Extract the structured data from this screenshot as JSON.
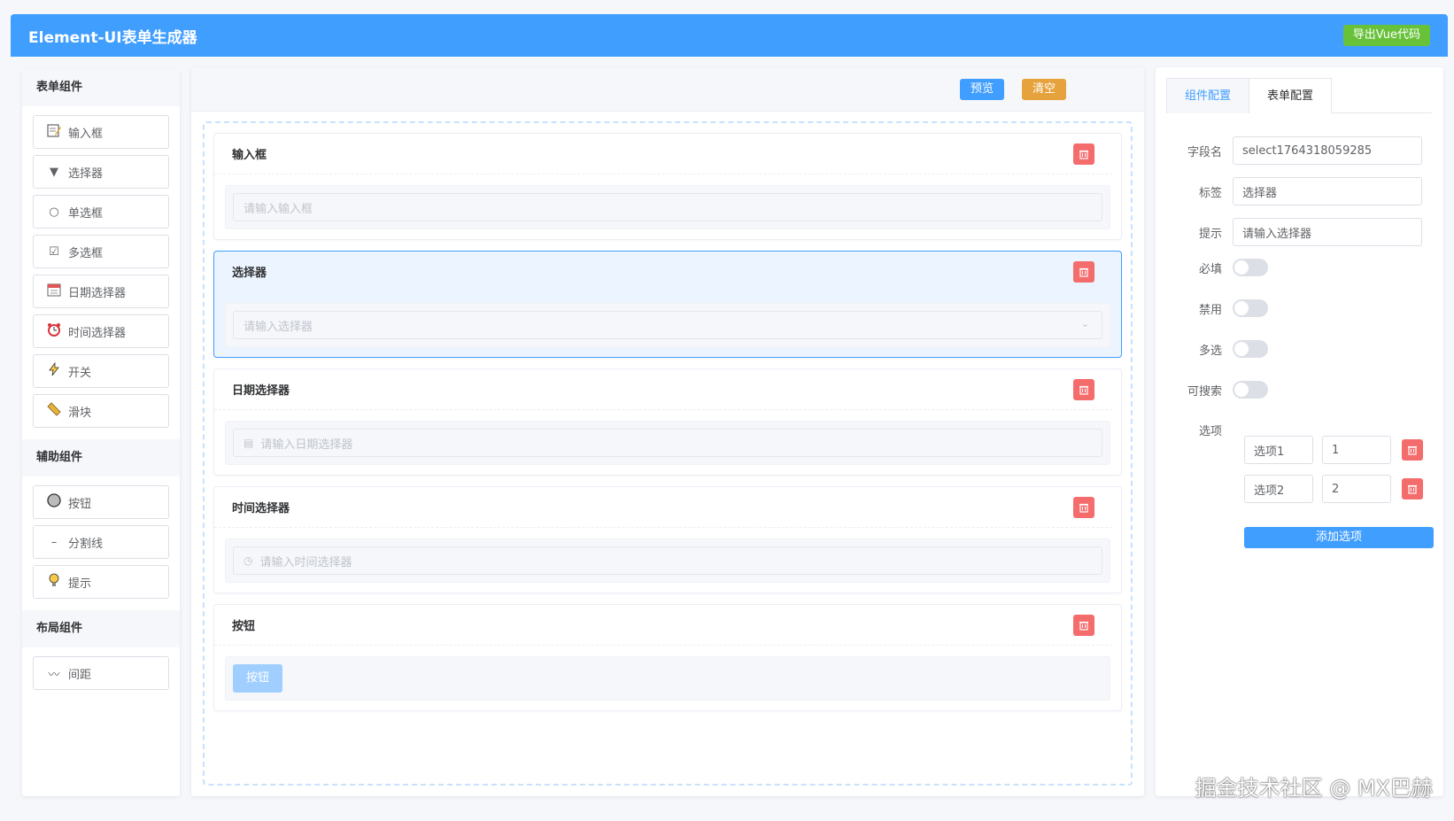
{
  "header": {
    "title": "Element-UI表单生成器",
    "export_label": "导出Vue代码"
  },
  "sidebar": {
    "groups": [
      {
        "title": "表单组件",
        "items": [
          {
            "label": "输入框",
            "icon": "memo-icon"
          },
          {
            "label": "选择器",
            "icon": "triangle-down-icon"
          },
          {
            "label": "单选框",
            "icon": "radio-icon"
          },
          {
            "label": "多选框",
            "icon": "checkbox-icon"
          },
          {
            "label": "日期选择器",
            "icon": "calendar-icon"
          },
          {
            "label": "时间选择器",
            "icon": "alarm-clock-icon"
          },
          {
            "label": "开关",
            "icon": "lightning-icon"
          },
          {
            "label": "滑块",
            "icon": "ruler-icon"
          }
        ]
      },
      {
        "title": "辅助组件",
        "items": [
          {
            "label": "按钮",
            "icon": "circle-button-icon"
          },
          {
            "label": "分割线",
            "icon": "dash-icon"
          },
          {
            "label": "提示",
            "icon": "bulb-icon"
          }
        ]
      },
      {
        "title": "布局组件",
        "items": [
          {
            "label": "间距",
            "icon": "wave-icon"
          }
        ]
      }
    ]
  },
  "toolbar": {
    "preview_label": "预览",
    "clear_label": "清空"
  },
  "canvas": {
    "items": [
      {
        "label": "输入框",
        "placeholder": "请输入输入框",
        "kind": "input"
      },
      {
        "label": "选择器",
        "placeholder": "请输入选择器",
        "kind": "select"
      },
      {
        "label": "日期选择器",
        "placeholder": "请输入日期选择器",
        "kind": "date"
      },
      {
        "label": "时间选择器",
        "placeholder": "请输入时间选择器",
        "kind": "time"
      },
      {
        "label": "按钮",
        "button_text": "按钮",
        "kind": "button"
      }
    ]
  },
  "config": {
    "tabs": [
      "组件配置",
      "表单配置"
    ],
    "field_name_label": "字段名",
    "field_name_value": "select1764318059285",
    "label_label": "标签",
    "label_value": "选择器",
    "hint_label": "提示",
    "hint_value": "请输入选择器",
    "required_label": "必填",
    "disabled_label": "禁用",
    "multiple_label": "多选",
    "searchable_label": "可搜索",
    "options_label": "选项",
    "options": [
      {
        "label": "选项1",
        "value": "1"
      },
      {
        "label": "选项2",
        "value": "2"
      }
    ],
    "add_option_label": "添加选项"
  },
  "watermark": "掘金技术社区 @ MX巴赫",
  "colors": {
    "primary": "#409eff",
    "success": "#67c23a",
    "warning": "#e6a23c",
    "danger": "#f56c6c"
  }
}
